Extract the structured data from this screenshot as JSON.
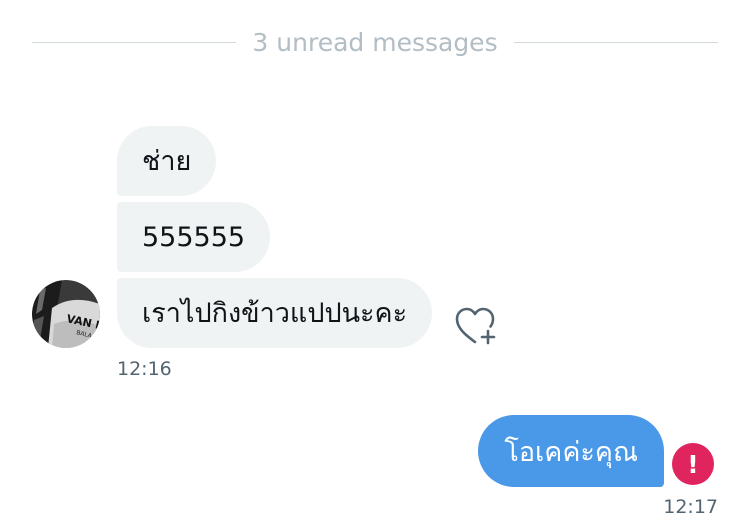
{
  "divider": {
    "label": "3 unread messages"
  },
  "incoming": {
    "messages": [
      {
        "text": "ช่าย"
      },
      {
        "text": "555555"
      },
      {
        "text": "เราไปกิงข้าวแปปนะคะ"
      }
    ],
    "time": "12:16",
    "avatar_text": "VAN HA",
    "avatar_subtext": "BALA",
    "react_icon": "heart-plus-icon"
  },
  "outgoing": {
    "message": "โอเคค่ะคุณ",
    "time": "12:17",
    "status_icon": "error-icon",
    "status_symbol": "!"
  },
  "colors": {
    "incoming_bubble": "#eff3f4",
    "outgoing_bubble": "#4a99e9",
    "error": "#e0245e",
    "muted_text": "#536471",
    "divider_text": "#b2bdc4"
  }
}
